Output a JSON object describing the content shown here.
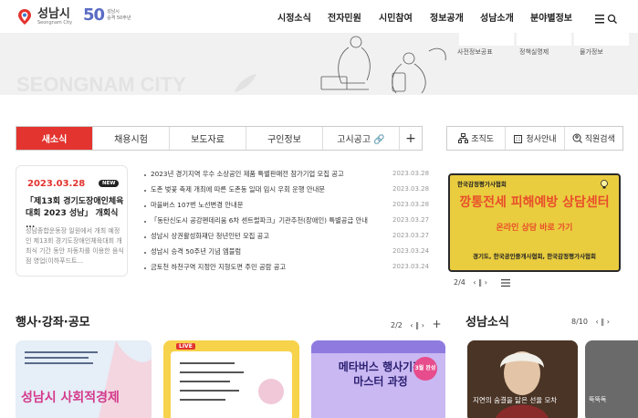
{
  "header": {
    "logo_ko": "성남시",
    "logo_en": "Seongnam City",
    "anniv_num": "50",
    "anniv_line1": "성남시",
    "anniv_line2": "승격 50주년",
    "gnb": [
      "시정소식",
      "전자민원",
      "시민참여",
      "정보공개",
      "성남소개",
      "분야별정보"
    ]
  },
  "hero": {
    "title": "SEONGNAM CITY",
    "quick": [
      "사전정보공표",
      "정책실명제",
      "물가정보"
    ]
  },
  "tabs": {
    "items": [
      "새소식",
      "채용시험",
      "보도자료",
      "구인정보",
      "고시공고 🔗"
    ],
    "plus": "+"
  },
  "right_buttons": [
    {
      "label": "조직도",
      "icon": "org-chart-icon"
    },
    {
      "label": "청사안내",
      "icon": "building-icon"
    },
    {
      "label": "직원검색",
      "icon": "search-person-icon"
    }
  ],
  "feature": {
    "date": "2023.03.28",
    "badge": "NEW",
    "title": "「제13회 경기도장애인체육대회 2023 성남」 개회식 ...",
    "body": "성남종합운동장 일원에서 개최 예정인 제13회 경기도장애인체육대회 개최식 기간 동안 자동차를 이용한 음식점 영업(이하푸드트..."
  },
  "news": [
    {
      "title": "2023년 경기지역 우수 소상공인 제품 특별판매전 참가기업 모집 공고",
      "date": "2023.03.28"
    },
    {
      "title": "도촌 벚꽃 축제 개최에 따른 도촌동 일대 임시 우회 운행 안내문",
      "date": "2023.03.28"
    },
    {
      "title": "마을버스 107번 노선변경 안내문",
      "date": "2023.03.28"
    },
    {
      "title": "「동탄신도시 공강펜데리움 6차 센트럴파크」기관추천(장애인) 특별공급 안내",
      "date": "2023.03.27"
    },
    {
      "title": "성남시 상권활성화재단 청년인턴 모집 공고",
      "date": "2023.03.27"
    },
    {
      "title": "성남시 승격 50주년 기념 엠블럼",
      "date": "2023.03.24"
    },
    {
      "title": "금토천 하천구역 지정안 지형도면 주민 공람 공고",
      "date": "2023.03.24"
    }
  ],
  "banner": {
    "top": "한국감정평가사협회",
    "main": "깡통전세 피해예방 상담센터",
    "sub": "온라인 상담 바로 가기",
    "foot": "경기도, 한국공인중개사협회, 한국감정평가사협회",
    "pager": "2/4",
    "controls": "‹ ‖ ›"
  },
  "events": {
    "title": "행사·강좌·공모",
    "pager": "2/2",
    "controls": "‹ ‖ ›",
    "plus": "+",
    "cards": [
      {
        "caption": "성남시 사회적경제"
      },
      {
        "caption": "LIVE"
      },
      {
        "caption": "메타버스 행사기획 마스터 과정",
        "badge": "3월 완성"
      }
    ]
  },
  "culture": {
    "title": "성남소식",
    "pager": "8/10",
    "controls": "‹ ‖ ›",
    "card_caption": "지연의 숨결을 닮은 선율 모차",
    "card2_caption": "뚝뚝독"
  }
}
